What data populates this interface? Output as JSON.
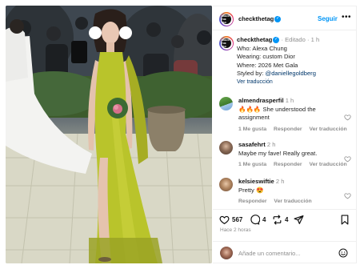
{
  "post": {
    "username": "checkthetag",
    "avatar_text": "CHECK THE TAG",
    "follow_label": "Seguir",
    "more_icon": "more-horizontal-icon",
    "edited_label": "Editado",
    "time_ago": "1 h",
    "caption_lines": [
      "Who: Alexa Chung",
      "Wearing: custom Dior",
      "Where: 2026 Met Gala"
    ],
    "styled_by_label": "Styled by:",
    "styled_by_handle": "@daniellegoldberg",
    "translate_label": "Ver traducción"
  },
  "comments": [
    {
      "username": "almendrasperfil",
      "time": "1 h",
      "text": "🔥🔥🔥 She understood the assignment",
      "likes": "1 Me gusta",
      "reply": "Responder",
      "translate": "Ver traducción"
    },
    {
      "username": "sasafehrt",
      "time": "2 h",
      "text": "Maybe my fave! Really great.",
      "likes": "1 Me gusta",
      "reply": "Responder",
      "translate": "Ver traducción"
    },
    {
      "username": "kelsieswiftie",
      "time": "2 h",
      "text": "Pretty 😍",
      "likes": "",
      "reply": "Responder",
      "translate": "Ver traducción"
    }
  ],
  "actions": {
    "likes_count": "567",
    "comments_count": "4",
    "reposts_count": "4",
    "posted_ago": "Hace 2 horas"
  },
  "composer": {
    "placeholder": "Añade un comentario..."
  },
  "colors": {
    "accent": "#0095f6",
    "dress": "#b7c22a",
    "text": "#262626",
    "muted": "#8e8e8e"
  }
}
